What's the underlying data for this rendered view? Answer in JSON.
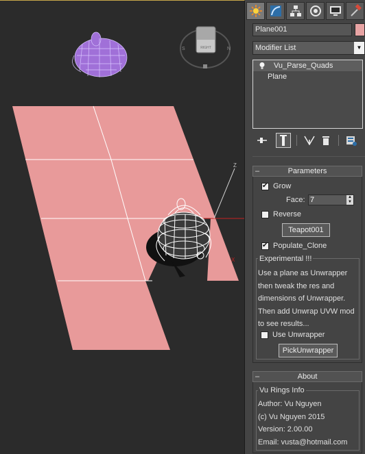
{
  "viewport": {
    "axis_label_z": "Z",
    "axis_label_x": "X",
    "viewcube_label": "RIGHT",
    "compass_labels": {
      "n": "N",
      "s": "S"
    },
    "colors": {
      "background": "#2b2b2b",
      "plane": "#e89a9a",
      "teapot_selected": "#a070d8",
      "teapot_wire": "#ffffff"
    }
  },
  "panel": {
    "tabs": [
      {
        "name": "create-tab",
        "icon": "sun-icon"
      },
      {
        "name": "modify-tab",
        "icon": "modify-icon"
      },
      {
        "name": "hierarchy-tab",
        "icon": "hierarchy-icon"
      },
      {
        "name": "motion-tab",
        "icon": "motion-icon"
      },
      {
        "name": "display-tab",
        "icon": "display-icon"
      },
      {
        "name": "utilities-tab",
        "icon": "hammer-icon"
      }
    ],
    "object_name": "Plane001",
    "object_color": "#e8a4a4",
    "modifier_list": "Modifier List",
    "stack": [
      "Vu_Parse_Quads",
      "Plane"
    ]
  },
  "parameters": {
    "title": "Parameters",
    "grow_label": "Grow",
    "grow_checked": true,
    "face_label": "Face:",
    "face_value": "7",
    "reverse_label": "Reverse",
    "reverse_checked": false,
    "teapot_button": "Teapot001",
    "populate_label": "Populate_Clone",
    "populate_checked": true,
    "experimental": {
      "title": "Experimental !!!",
      "lines": [
        "Use a plane as  Unwrapper",
        "then tweak the res and",
        "dimensions of Unwrapper.",
        "Then add Unwrap UVW mod",
        "to see results..."
      ],
      "use_unwrapper_label": "Use Unwrapper",
      "use_unwrapper_checked": false,
      "pick_button": "PickUnwrapper"
    }
  },
  "about": {
    "title": "About",
    "group_title": "Vu Rings Info",
    "author": "Author: Vu Nguyen",
    "copyright": "(c) Vu Nguyen 2015",
    "version": "Version: 2.00.00",
    "email": "Email: vusta@hotmail.com"
  }
}
